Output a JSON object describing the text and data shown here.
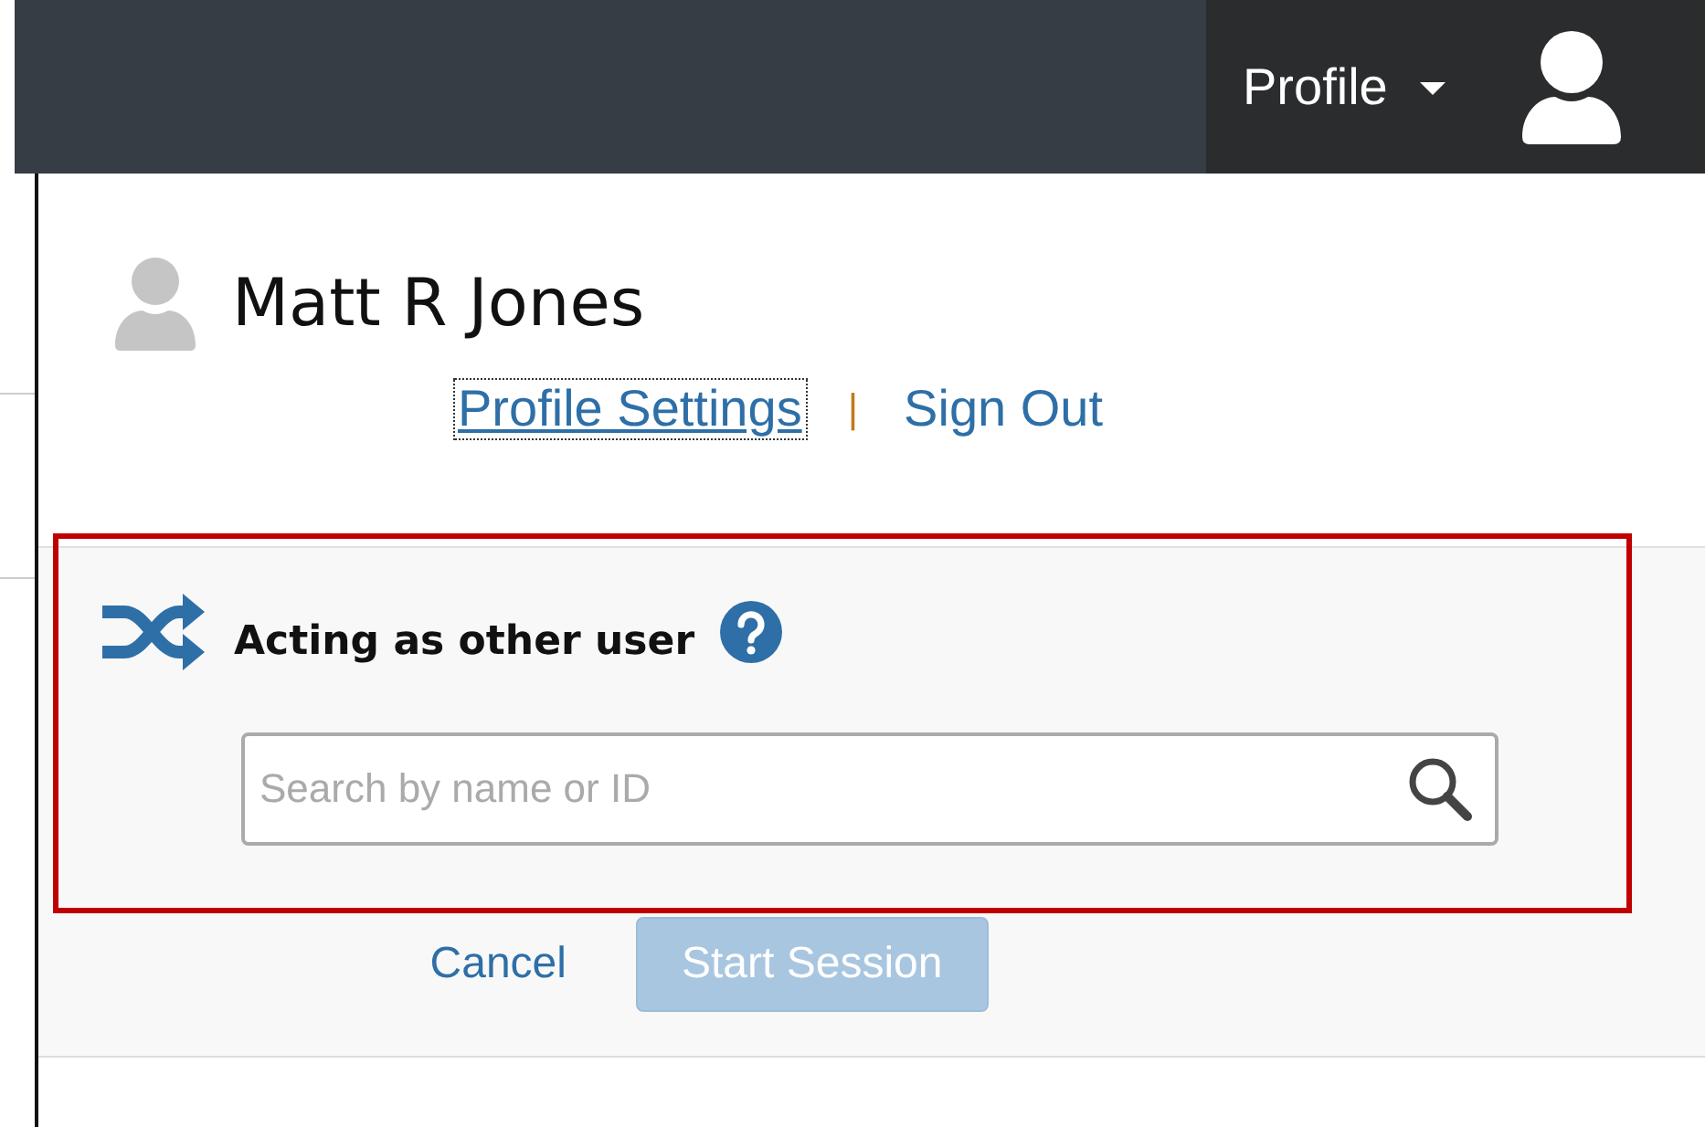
{
  "top_bar": {
    "profile_menu": {
      "label": "Profile",
      "expanded": true
    }
  },
  "profile_panel": {
    "user_name": "Matt R Jones",
    "links": [
      {
        "label": "Profile Settings",
        "focused": true
      },
      {
        "label": "Sign Out",
        "focused": false
      }
    ],
    "separator": "|"
  },
  "acting_as": {
    "title": "Acting as other user",
    "highlighted": true,
    "search": {
      "placeholder": "Search by name or ID"
    }
  },
  "buttons": [
    {
      "label": "Cancel",
      "kind": "link",
      "disabled": false
    },
    {
      "label": "Start Session",
      "kind": "primary",
      "disabled": true
    }
  ]
}
